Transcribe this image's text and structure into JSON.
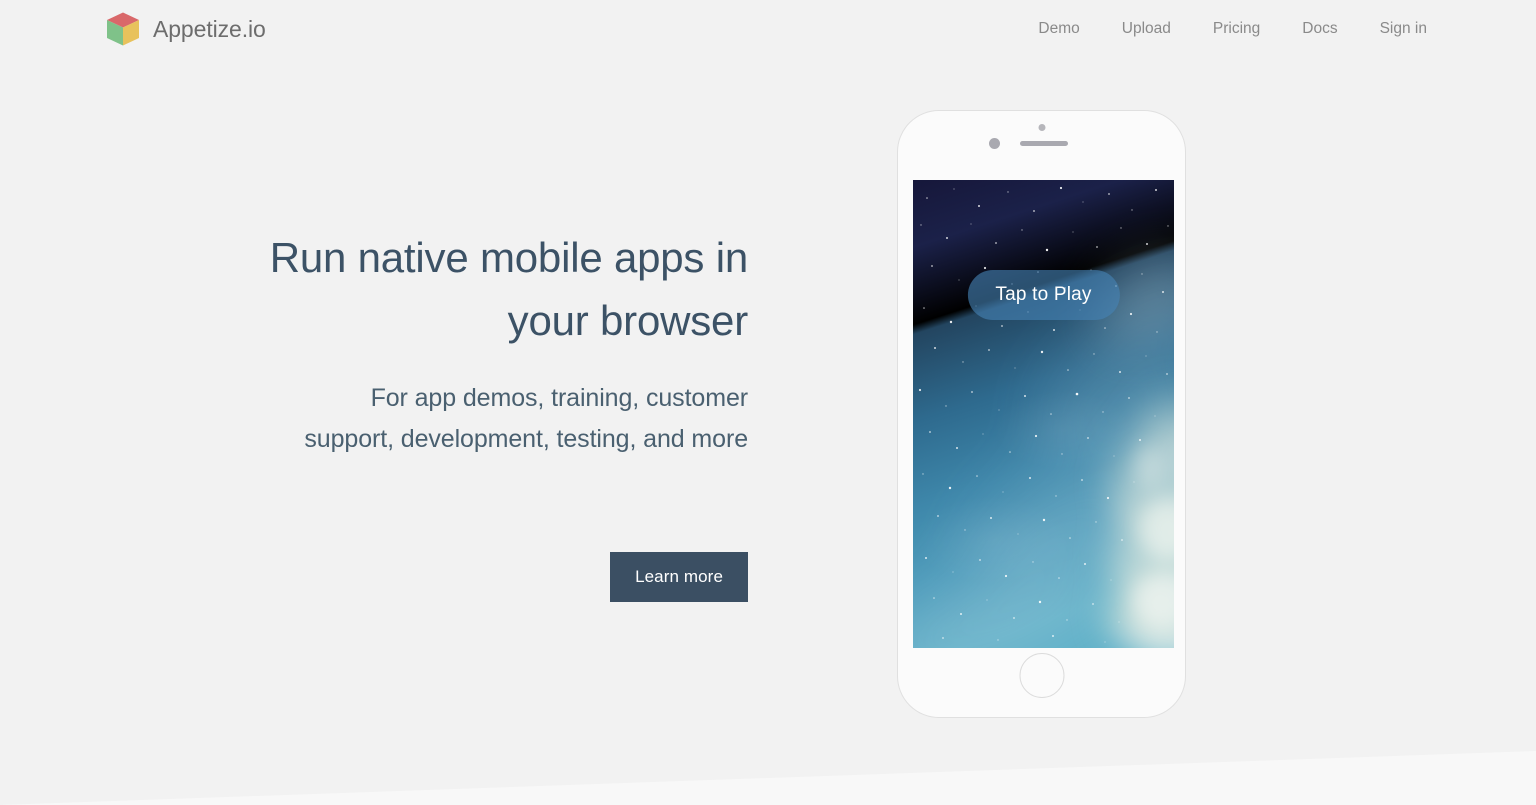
{
  "page": {
    "background_color": "#f2f2f2"
  },
  "header": {
    "brand": {
      "name": "Appetize.io",
      "logo_icon": "cube-logo-icon",
      "logo_colors": {
        "top": "#d9686a",
        "left": "#7fc289",
        "right": "#e8c25c"
      }
    },
    "nav": {
      "items": [
        {
          "label": "Demo"
        },
        {
          "label": "Upload"
        },
        {
          "label": "Pricing"
        },
        {
          "label": "Docs"
        },
        {
          "label": "Sign in"
        }
      ],
      "text_color": "#8a8a8a"
    }
  },
  "hero": {
    "headline_line1": "Run native mobile apps in",
    "headline_line2": "your browser",
    "subhead_line1": "For app demos, training, customer",
    "subhead_line2": "support, development, testing, and more",
    "cta_label": "Learn more",
    "headline_color": "#3c5266",
    "cta_background": "#3b4f63",
    "cta_text_color": "#ffffff"
  },
  "phone": {
    "device": "iphone-mockup",
    "camera_icon": "camera-dot-icon",
    "sensor_icon": "proximity-sensor-icon",
    "speaker_icon": "earpiece-speaker-icon",
    "home_button_icon": "home-button-icon",
    "screen": {
      "wallpaper": "nebula-starfield-wallpaper",
      "sky_top_color": "#1b1c3a",
      "sky_bottom_color": "#57a2c4",
      "play_button_label": "Tap to Play",
      "play_button_color": "#4682b4"
    }
  }
}
